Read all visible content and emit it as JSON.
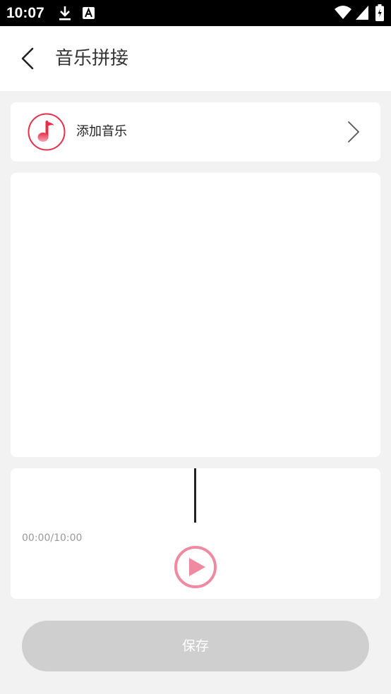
{
  "status_bar": {
    "time": "10:07",
    "icons": [
      "download-icon",
      "a-notification-icon",
      "wifi-icon",
      "signal-icon",
      "battery-icon"
    ]
  },
  "header": {
    "back_icon": "chevron-left-icon",
    "title": "音乐拼接"
  },
  "add_music": {
    "icon": "music-note-icon",
    "label": "添加音乐",
    "arrow_icon": "chevron-right-icon"
  },
  "timeline": {
    "time_readout": "00:00/10:00",
    "play_icon": "play-icon"
  },
  "actions": {
    "save_label": "保存"
  },
  "colors": {
    "accent": "#f08aa0",
    "music_icon_red": "#e6304a",
    "save_disabled": "#cfcfcf",
    "background": "#f2f2f2"
  }
}
